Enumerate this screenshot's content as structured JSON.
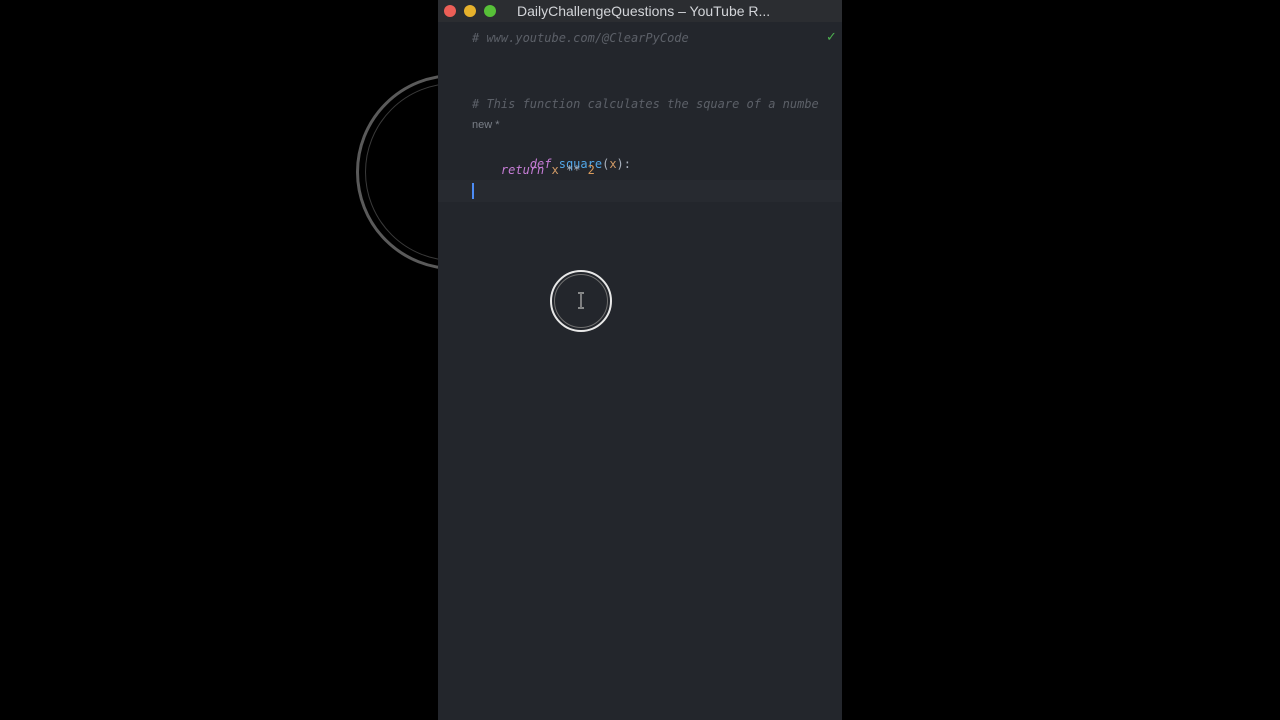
{
  "window": {
    "title": "DailyChallengeQuestions  – YouTube R..."
  },
  "editor": {
    "lines": {
      "comment_url": "# www.youtube.com/@ClearPyCode",
      "comment_desc": "# This function calculates the square of a numbe",
      "hint": "new *",
      "def_kw": "def",
      "func_name": "square",
      "open_paren": "(",
      "param": "x",
      "close_paren": "):",
      "return_kw": "return",
      "return_var": "x",
      "operator": "**",
      "number": "2"
    },
    "status_icon": "checkmark-icon"
  },
  "colors": {
    "background": "#000000",
    "editor_bg": "#23262c",
    "titlebar_bg": "#2b2d31",
    "close": "#ec5f57",
    "minimize": "#e6b12c",
    "maximize": "#57c038",
    "keyword": "#c77dd7",
    "function": "#52a7e8",
    "parameter": "#d19a66",
    "number": "#d99a5b",
    "comment": "#5c6068",
    "caret": "#4d8cf5",
    "check": "#4cae4f"
  }
}
